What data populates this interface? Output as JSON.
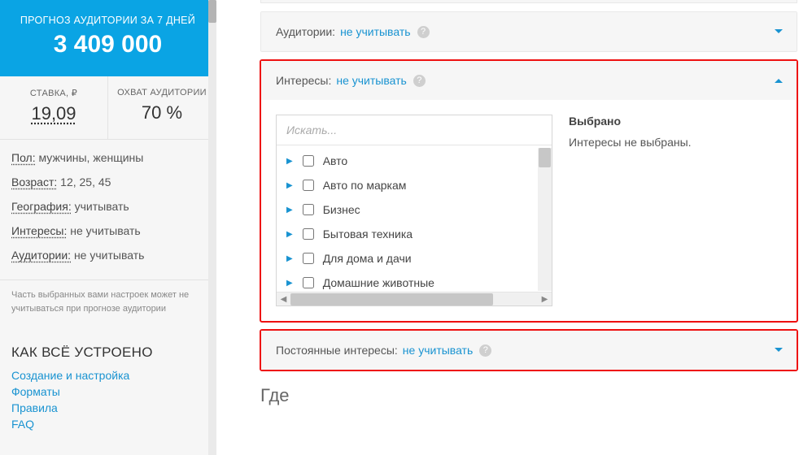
{
  "sidebar": {
    "forecast": {
      "title": "ПРОГНОЗ АУДИТОРИИ ЗА 7 ДНЕЙ",
      "value": "3 409 000"
    },
    "stake": {
      "label": "СТАВКА, ₽",
      "value": "19,09"
    },
    "reach": {
      "label": "ОХВАТ АУДИТОРИИ",
      "value": "70 %"
    },
    "filters": {
      "gender_label": "Пол:",
      "gender_value": "мужчины, женщины",
      "age_label": "Возраст:",
      "age_value": "12, 25, 45",
      "geo_label": "География:",
      "geo_value": "учитывать",
      "interests_label": "Интересы:",
      "interests_value": "не учитывать",
      "audiences_label": "Аудитории:",
      "audiences_value": "не учитывать"
    },
    "note": "Часть выбранных вами настроек может не учитываться при прогнозе аудитории",
    "how": {
      "title": "КАК ВСЁ УСТРОЕНО",
      "links": [
        "Создание и настройка",
        "Форматы",
        "Правила",
        "FAQ"
      ]
    }
  },
  "blocks": {
    "audiences": {
      "title": "Аудитории:",
      "value": "не учитывать"
    },
    "interests": {
      "title": "Интересы:",
      "value": "не учитывать",
      "search_placeholder": "Искать...",
      "items": [
        "Авто",
        "Авто по маркам",
        "Бизнес",
        "Бытовая техника",
        "Для дома и дачи",
        "Домашние животные"
      ],
      "selected_title": "Выбрано",
      "selected_empty": "Интересы не выбраны."
    },
    "constant_interests": {
      "title": "Постоянные интересы:",
      "value": "не учитывать"
    }
  },
  "section_where": "Где"
}
